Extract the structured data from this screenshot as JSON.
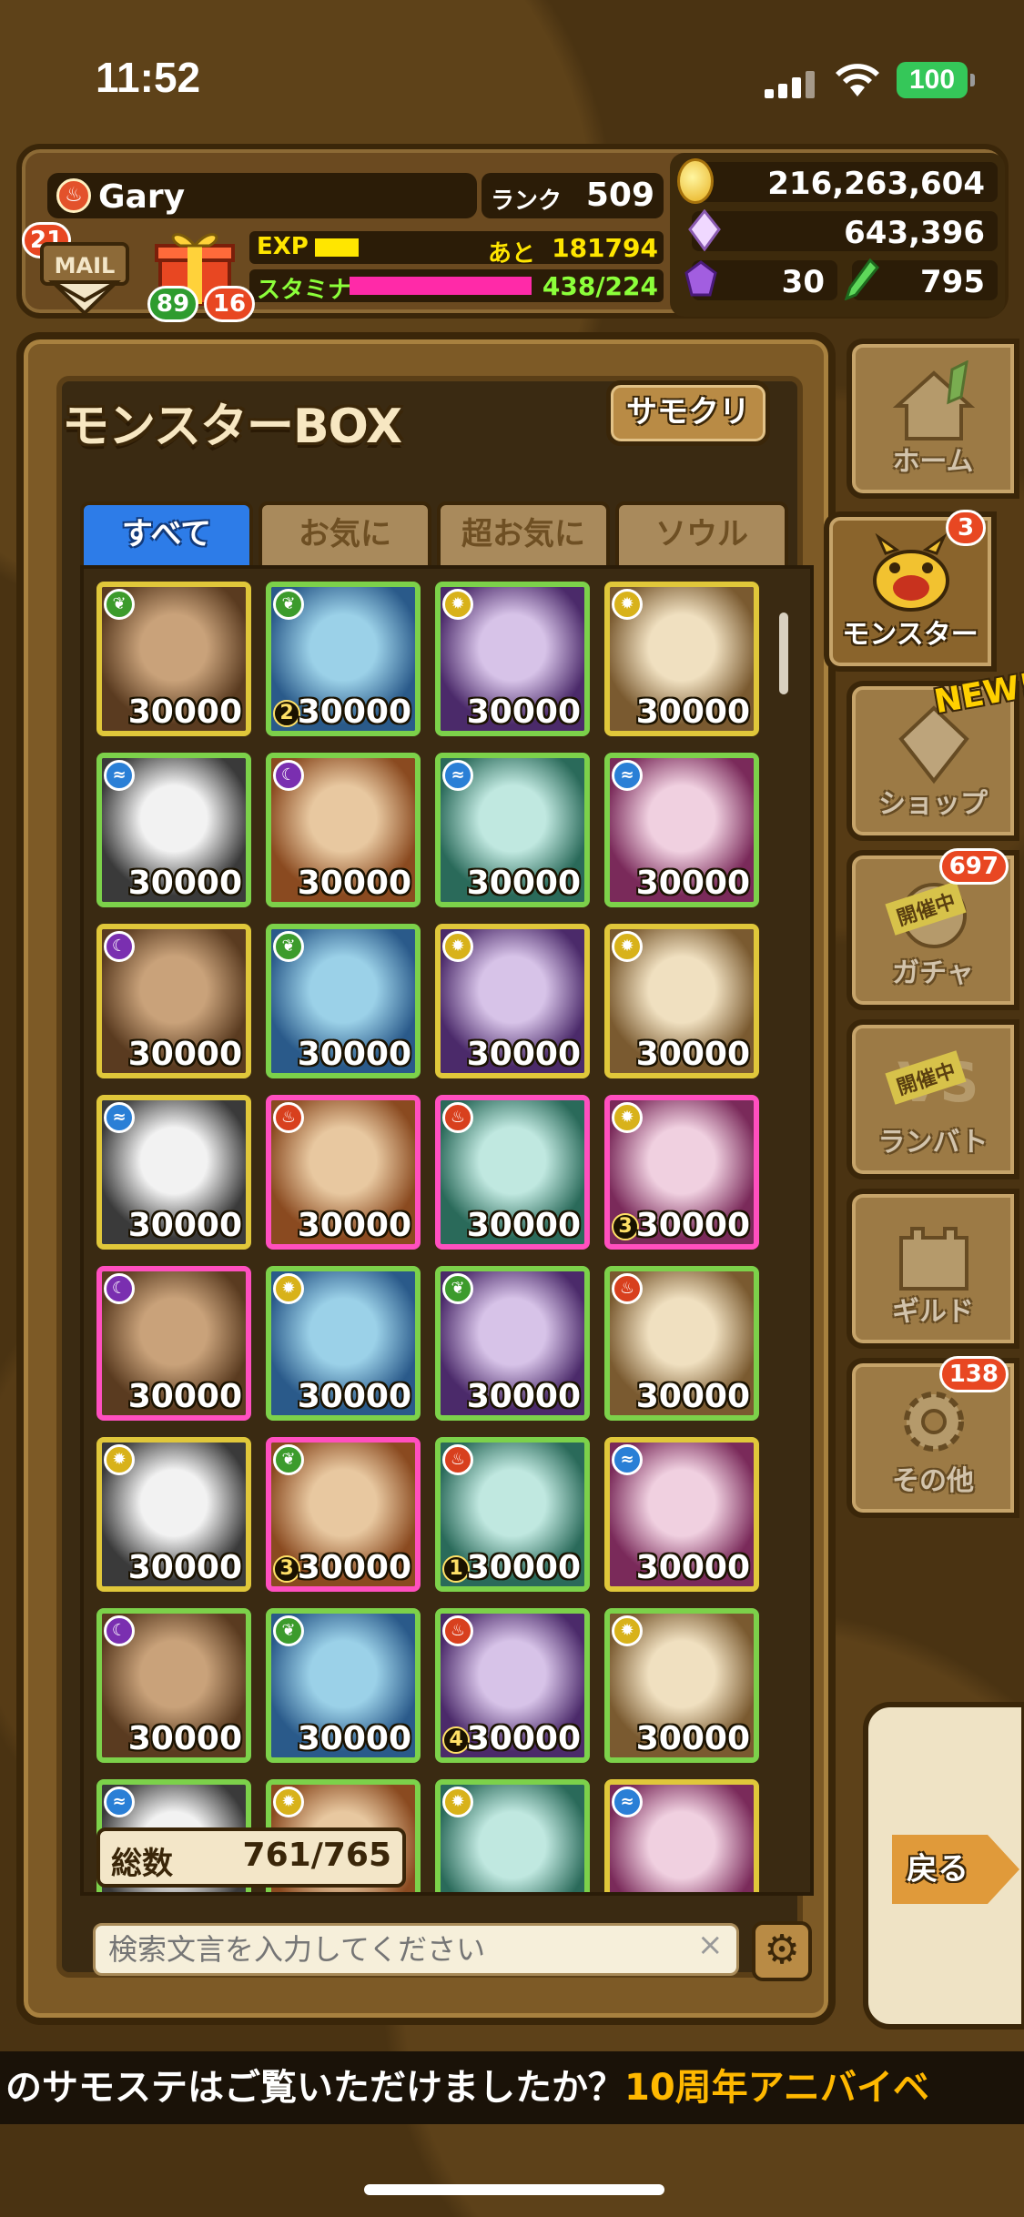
{
  "status_bar": {
    "time": "11:52",
    "battery": "100"
  },
  "player": {
    "name": "Gary",
    "rank_label": "ランク",
    "rank": "509",
    "exp_label": "EXP",
    "exp_remaining_label": "あと",
    "exp_remaining": "181794",
    "exp_fill": 0.28,
    "stamina_label": "スタミナ",
    "stamina": "438/224",
    "stamina_fill": 1.0
  },
  "mail": {
    "label": "MAIL",
    "badge": "21"
  },
  "gift": {
    "green_badge": "89",
    "red_badge": "16"
  },
  "currency": {
    "coins": "216,263,604",
    "crystals": "643,396",
    "gems": "30",
    "keys": "795"
  },
  "box": {
    "title": "モンスターBOX",
    "samokuri_label": "サモクリ",
    "tabs": [
      "すべて",
      "お気に",
      "超お気に",
      "ソウル"
    ],
    "active_tab": 0,
    "total_label": "総数",
    "total_value": "761/765",
    "search_placeholder": "検索文言を入力してください",
    "search_clear": "×"
  },
  "monsters": [
    {
      "level": "30000",
      "element": "wood",
      "frame": "light",
      "plus": ""
    },
    {
      "level": "30000",
      "element": "wood",
      "frame": "wood",
      "plus": "2"
    },
    {
      "level": "30000",
      "element": "light",
      "frame": "wood",
      "plus": ""
    },
    {
      "level": "30000",
      "element": "light",
      "frame": "light",
      "plus": ""
    },
    {
      "level": "30000",
      "element": "water",
      "frame": "wood",
      "plus": ""
    },
    {
      "level": "30000",
      "element": "dark",
      "frame": "wood",
      "plus": ""
    },
    {
      "level": "30000",
      "element": "water",
      "frame": "wood",
      "plus": ""
    },
    {
      "level": "30000",
      "element": "water",
      "frame": "wood",
      "plus": ""
    },
    {
      "level": "30000",
      "element": "dark",
      "frame": "light",
      "plus": ""
    },
    {
      "level": "30000",
      "element": "wood",
      "frame": "wood",
      "plus": ""
    },
    {
      "level": "30000",
      "element": "light",
      "frame": "light",
      "plus": ""
    },
    {
      "level": "30000",
      "element": "light",
      "frame": "light",
      "plus": ""
    },
    {
      "level": "30000",
      "element": "water",
      "frame": "light",
      "plus": ""
    },
    {
      "level": "30000",
      "element": "fire",
      "frame": "rainbow",
      "plus": ""
    },
    {
      "level": "30000",
      "element": "fire",
      "frame": "rainbow",
      "plus": ""
    },
    {
      "level": "30000",
      "element": "light",
      "frame": "rainbow",
      "plus": "3"
    },
    {
      "level": "30000",
      "element": "dark",
      "frame": "rainbow",
      "plus": ""
    },
    {
      "level": "30000",
      "element": "light",
      "frame": "wood",
      "plus": ""
    },
    {
      "level": "30000",
      "element": "wood",
      "frame": "wood",
      "plus": ""
    },
    {
      "level": "30000",
      "element": "fire",
      "frame": "wood",
      "plus": ""
    },
    {
      "level": "30000",
      "element": "light",
      "frame": "light",
      "plus": ""
    },
    {
      "level": "30000",
      "element": "wood",
      "frame": "rainbow",
      "plus": "3"
    },
    {
      "level": "30000",
      "element": "fire",
      "frame": "wood",
      "plus": "1"
    },
    {
      "level": "30000",
      "element": "water",
      "frame": "light",
      "plus": ""
    },
    {
      "level": "30000",
      "element": "dark",
      "frame": "wood",
      "plus": ""
    },
    {
      "level": "30000",
      "element": "wood",
      "frame": "wood",
      "plus": ""
    },
    {
      "level": "30000",
      "element": "fire",
      "frame": "wood",
      "plus": "4"
    },
    {
      "level": "30000",
      "element": "light",
      "frame": "wood",
      "plus": ""
    },
    {
      "level": "",
      "element": "water",
      "frame": "wood",
      "plus": ""
    },
    {
      "level": "",
      "element": "light",
      "frame": "wood",
      "plus": ""
    },
    {
      "level": "",
      "element": "light",
      "frame": "wood",
      "plus": ""
    },
    {
      "level": "",
      "element": "water",
      "frame": "light",
      "plus": ""
    }
  ],
  "nav": {
    "home": "ホーム",
    "monster": "モンスター",
    "monster_badge": "3",
    "shop": "ショップ",
    "shop_new": "NEW!",
    "gacha": "ガチャ",
    "gacha_badge": "697",
    "gacha_ribbon": "開催中",
    "battle": "ランバト",
    "battle_ribbon": "開催中",
    "guild": "ギルド",
    "other": "その他",
    "other_badge": "138",
    "back": "戻る"
  },
  "ticker": {
    "white": "のサモステはご覧いただけましたか？",
    "yellow": "10周年アニバイベ"
  },
  "colors": {
    "active_tab": "#2d7ce8",
    "badge_red": "#e84722",
    "badge_green": "#2e9c2e",
    "accent": "#ffb800"
  }
}
